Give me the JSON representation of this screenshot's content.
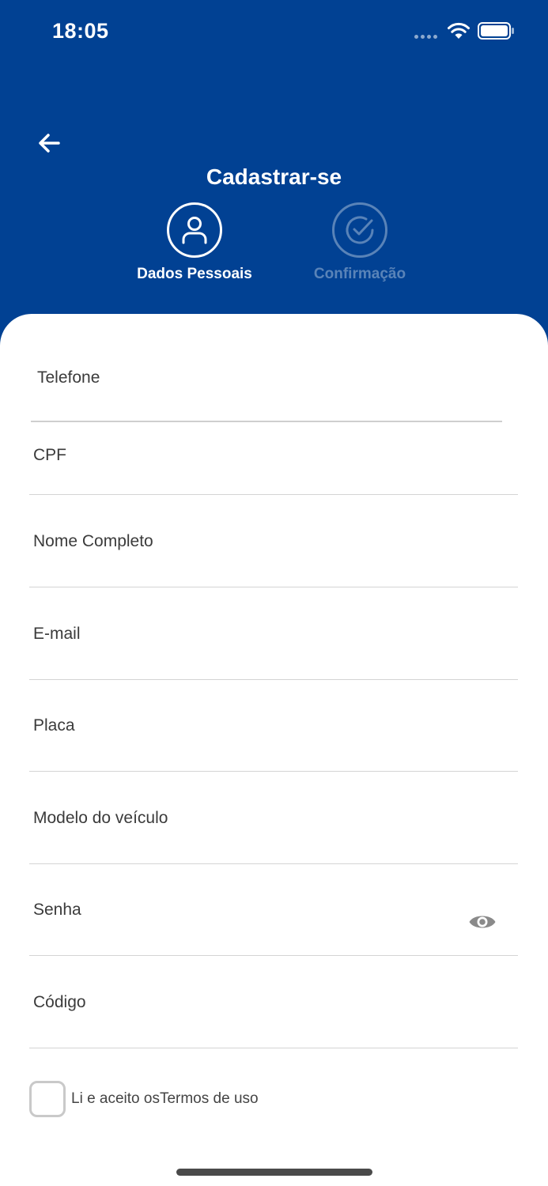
{
  "status_bar": {
    "time": "18:05"
  },
  "header": {
    "title": "Cadastrar-se",
    "steps": [
      {
        "label": "Dados Pessoais",
        "icon": "person-icon",
        "active": true
      },
      {
        "label": "Confirmação",
        "icon": "check-circle-icon",
        "active": false
      }
    ]
  },
  "form": {
    "fields": [
      {
        "label": "Telefone"
      },
      {
        "label": "CPF"
      },
      {
        "label": "Nome Completo"
      },
      {
        "label": "E-mail"
      },
      {
        "label": "Placa"
      },
      {
        "label": "Modelo do veículo"
      },
      {
        "label": "Senha",
        "icon": "eye-icon"
      },
      {
        "label": "Código"
      }
    ],
    "terms": {
      "text": "Li e aceito osTermos de uso"
    }
  },
  "colors": {
    "primary": "#014193",
    "background": "#ffffff",
    "divider": "#d4d4d4"
  }
}
